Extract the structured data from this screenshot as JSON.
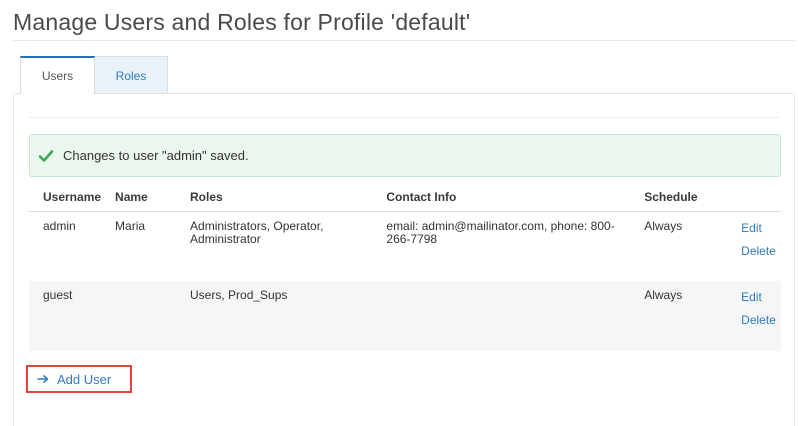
{
  "page": {
    "title": "Manage Users and Roles for Profile 'default'"
  },
  "tabs": [
    {
      "label": "Users",
      "active": true
    },
    {
      "label": "Roles",
      "active": false
    }
  ],
  "alert": {
    "icon": "check-icon",
    "message": "Changes to user \"admin\" saved."
  },
  "table": {
    "headers": {
      "username": "Username",
      "name": "Name",
      "roles": "Roles",
      "contact": "Contact Info",
      "schedule": "Schedule"
    },
    "rows": [
      {
        "username": "admin",
        "name": "Maria",
        "roles": "Administrators, Operator, Administrator",
        "contact": "email: admin@mailinator.com, phone: 800-266-7798",
        "schedule": "Always",
        "edit": "Edit",
        "delete": "Delete"
      },
      {
        "username": "guest",
        "name": "",
        "roles": "Users, Prod_Sups",
        "contact": "",
        "schedule": "Always",
        "edit": "Edit",
        "delete": "Delete"
      }
    ]
  },
  "add_user": {
    "icon": "arrow-right-icon",
    "label": "Add User"
  },
  "colors": {
    "accent": "#2f7bbf",
    "success_bg": "#ebf7ee",
    "success_icon": "#3aa856",
    "highlight_border": "#d9473f"
  }
}
